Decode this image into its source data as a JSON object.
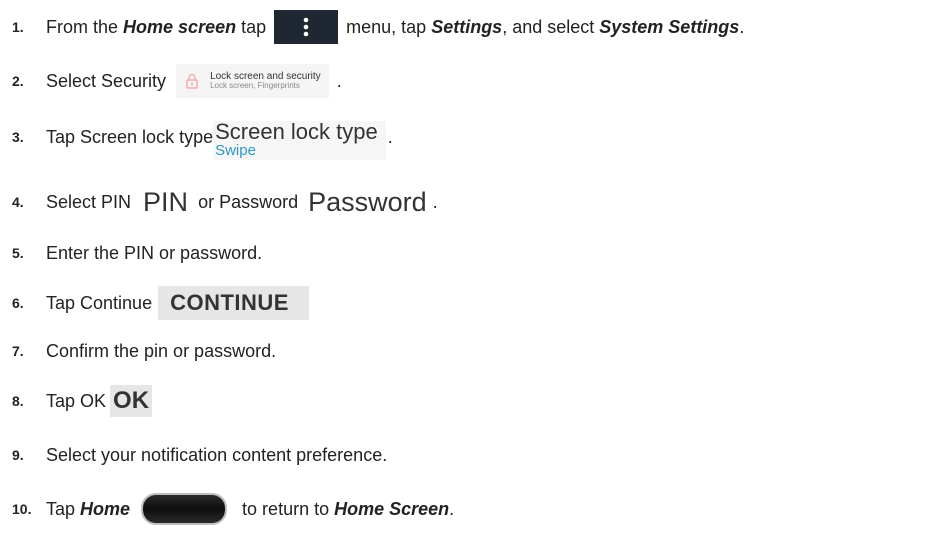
{
  "steps": [
    {
      "number": "1.",
      "text_a": "From the",
      "bold_a": "Home screen",
      "text_b": "tap",
      "text_c": "menu, tap",
      "bold_b": "Settings",
      "text_d": ", and select",
      "bold_c": "System Settings",
      "text_e": "."
    },
    {
      "number": "2.",
      "text_a": "Select Security",
      "text_b": "."
    },
    {
      "number": "3.",
      "text_a": "Tap Screen lock type",
      "text_b": "."
    },
    {
      "number": "4.",
      "text_a": "Select PIN",
      "text_b": "or Password",
      "text_c": "."
    },
    {
      "number": "5.",
      "text_a": "Enter the PIN or password."
    },
    {
      "number": "6.",
      "text_a": "Tap Continue"
    },
    {
      "number": "7.",
      "text_a": "Confirm the pin or password."
    },
    {
      "number": "8.",
      "text_a": "Tap OK"
    },
    {
      "number": "9.",
      "text_a": "Select your notification content preference."
    },
    {
      "number": "10.",
      "text_a": "Tap",
      "bold_a": "Home",
      "text_b": "to return to",
      "bold_b": "Home Screen",
      "text_c": "."
    }
  ],
  "ui": {
    "menu_icon": "vertical-dots-icon",
    "security_icon": "lock-icon",
    "security_title": "Lock screen and security",
    "security_subtitle": "Lock screen, Fingerprints",
    "lock_type_title": "Screen lock type",
    "lock_type_value": "Swipe",
    "pin_label": "PIN",
    "password_label": "Password",
    "continue_label": "CONTINUE",
    "ok_label": "OK",
    "home_icon": "home-button-icon"
  },
  "colors": {
    "menu_button_bg": "#1f2733",
    "accent_blue": "#2f97c4",
    "button_gray": "#e6e6e6"
  }
}
